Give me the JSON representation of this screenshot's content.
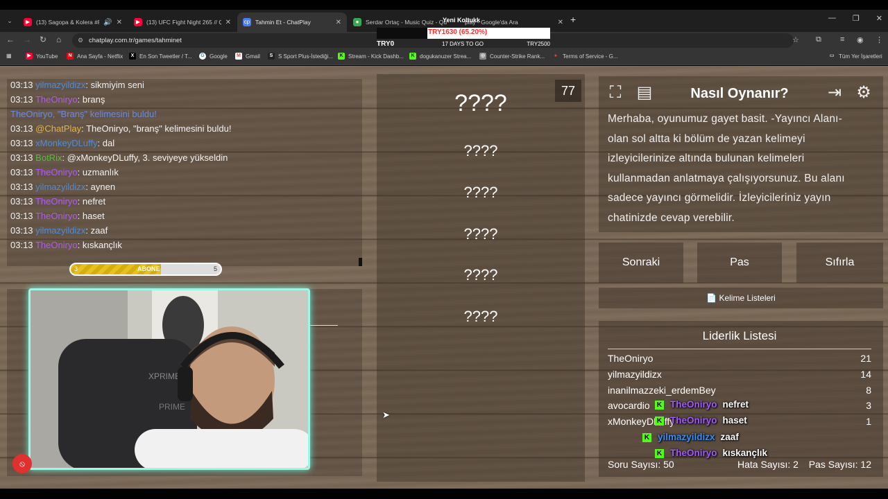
{
  "browser": {
    "tabs": [
      {
        "title": "(13) Sagopa & Kolera #Play",
        "icon_color": "#ff0033",
        "audio": true
      },
      {
        "title": "(13) UFC Fight Night 265 // QA",
        "icon_color": "#ff0033",
        "audio": false
      },
      {
        "title": "Tahmin Et - ChatPlay",
        "icon_color": "#4a7cf6",
        "audio": false
      },
      {
        "title": "Serdar Ortaç - Music Quiz - Qu",
        "icon_color": "#34a853",
        "audio": false
      },
      {
        "title": "play - Google'da Ara",
        "icon_color": "#4285f4",
        "audio": false
      }
    ],
    "url": "chatplay.com.tr/games/tahminet",
    "bookmarks": [
      "YouTube",
      "Ana Sayfa - Netflix",
      "En Son Tweetler / T...",
      "Google",
      "Gmail",
      "S Sport Plus-İstediği...",
      "Stream - Kick Dashb...",
      "dogukanuzer Strea...",
      "Counter-Strike Rank...",
      "Terms of Service - G..."
    ],
    "all_bookmarks": "Tüm Yer İşaretleri",
    "icons": {
      "back": "arrow-left-icon",
      "forward": "arrow-right-icon",
      "reload": "reload-icon",
      "home": "home-icon",
      "star": "star-icon",
      "extensions": "puzzle-icon",
      "profile": "profile-icon",
      "menu": "kebab-menu-icon"
    }
  },
  "goal_overlay": {
    "title": "Yeni Koltukk",
    "current": "TRY1630 (65.20%)",
    "progress": 0.652,
    "start": "TRY0",
    "days_left": "17 DAYS TO GO",
    "target": "TRY2500"
  },
  "chat": [
    {
      "time": "03:13",
      "user": "yilmazyildizx",
      "color": "blue",
      "msg": ": sikmiyim seni"
    },
    {
      "time": "03:13",
      "user": "TheOniryo",
      "color": "purple",
      "msg": ": branş"
    },
    {
      "time": "",
      "user": "",
      "color": "sys",
      "msg": "TheOniryo, \"Branş\" kelimesini buldu!"
    },
    {
      "time": "03:13",
      "user": "@ChatPlay",
      "color": "gold",
      "msg": ": TheOniryo, \"branş\" kelimesini buldu!"
    },
    {
      "time": "03:13",
      "user": "xMonkeyDLuffy",
      "color": "blue",
      "msg": ": dal"
    },
    {
      "time": "03:13",
      "user": "BotRix",
      "color": "green",
      "msg": ": @xMonkeyDLuffy, 3. seviyeye yükseldin"
    },
    {
      "time": "03:13",
      "user": "TheOniryo",
      "color": "purple",
      "msg": ": uzmanlık"
    },
    {
      "time": "03:13",
      "user": "yilmazyildizx",
      "color": "blue",
      "msg": ": aynen"
    },
    {
      "time": "03:13",
      "user": "TheOniryo",
      "color": "purple",
      "msg": ": nefret"
    },
    {
      "time": "03:13",
      "user": "TheOniryo",
      "color": "purple",
      "msg": ": haset"
    },
    {
      "time": "03:13",
      "user": "yilmazyildizx",
      "color": "blue",
      "msg": ": zaaf"
    },
    {
      "time": "03:13",
      "user": "TheOniryo",
      "color": "purple",
      "msg": ": kıskançlık"
    }
  ],
  "sub_goal": {
    "current": "3",
    "label": "ABONE",
    "target": "5",
    "progress": 0.6
  },
  "board": {
    "timer": "77",
    "main_word": "????",
    "words": [
      "????",
      "????",
      "????",
      "????",
      "????"
    ]
  },
  "howto": {
    "title": "Nasıl Oynanır?",
    "text": "Merhaba, oyunumuz gayet basit. -Yayıncı Alanı- olan sol altta ki bölüm de yazan kelimeyi izleyicilerinize altında bulunan kelimeleri kullanmadan anlatmaya çalışıyorsunuz. Bu alanı sadece yayıncı görmelidir. İzleyicileriniz yayın chatinizde cevap verebilir.",
    "icons": [
      "fullscreen-icon",
      "document-icon",
      "exit-icon",
      "settings-gear-icon"
    ]
  },
  "buttons": {
    "next": "Sonraki",
    "pass": "Pas",
    "reset": "Sıfırla",
    "word_lists": "Kelime Listeleri"
  },
  "leaderboard": {
    "title": "Liderlik Listesi",
    "rows": [
      {
        "name": "TheOniryo",
        "score": "21"
      },
      {
        "name": "yilmazyildizx",
        "score": "14"
      },
      {
        "name": "inanilmazzeki_erdemBey",
        "score": "8"
      },
      {
        "name": "avocardio",
        "score": "3"
      },
      {
        "name": "xMonkeyDLuffy",
        "score": "1"
      }
    ],
    "questions": "Soru Sayısı: 50",
    "errors": "Hata Sayısı: 2",
    "passes": "Pas Sayısı: 12"
  },
  "overlay_chat": [
    {
      "user": "TheOniryo",
      "msg": "nefret",
      "color": "purple"
    },
    {
      "user": "TheOniryo",
      "msg": "haset",
      "color": "purple"
    },
    {
      "user": "yilmazyildizx",
      "msg": "zaaf",
      "color": "blue"
    },
    {
      "user": "TheOniryo",
      "msg": "kıskançlık",
      "color": "purple"
    }
  ]
}
